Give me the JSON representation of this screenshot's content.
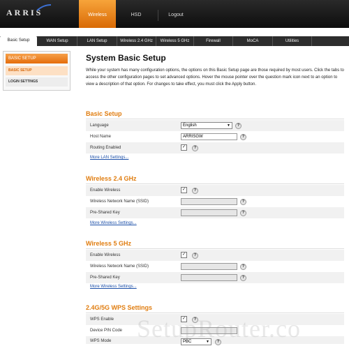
{
  "brand": {
    "name": "ARRIS"
  },
  "topnav": [
    {
      "label": "Wireless"
    },
    {
      "label": "HSD"
    },
    {
      "label": "Logout"
    }
  ],
  "tabs": [
    {
      "label": "Basic Setup"
    },
    {
      "label": "WAN Setup"
    },
    {
      "label": "LAN Setup"
    },
    {
      "label": "Wireless 2.4 GHz"
    },
    {
      "label": "Wireless 5 GHz"
    },
    {
      "label": "Firewall"
    },
    {
      "label": "MoCA"
    },
    {
      "label": "Utilities"
    }
  ],
  "sidebar": {
    "heading": "BASIC SETUP",
    "items": [
      {
        "label": "BASIC SETUP"
      },
      {
        "label": "LOGIN SETTINGS"
      }
    ]
  },
  "page": {
    "title": "System Basic Setup",
    "intro": "While your system has many configuration options, the options on this Basic Setup page are those required by most users. Click the tabs to access the other configuration pages to set advanced options. Hover the mouse pointer over the question mark icon next to an option to view a description of that option. For changes to take effect, you must click the Apply button."
  },
  "basic": {
    "title": "Basic Setup",
    "language_label": "Language",
    "language_value": "English",
    "hostname_label": "Host Name",
    "hostname_value": "ARRISGW",
    "routing_label": "Routing Enabled",
    "more": "More LAN Settings..."
  },
  "w24": {
    "title": "Wireless 2.4 GHz",
    "enable_label": "Enable Wireless",
    "ssid_label": "Wireless Network Name (SSID)",
    "psk_label": "Pre-Shared Key",
    "more": "More Wireless Settings..."
  },
  "w5": {
    "title": "Wireless 5 GHz",
    "enable_label": "Enable Wireless",
    "ssid_label": "Wireless Network Name (SSID)",
    "psk_label": "Pre-Shared Key",
    "more": "More Wireless Settings..."
  },
  "wps": {
    "title": "2.4G/5G WPS Settings",
    "enable_label": "WPS Enable",
    "pin_label": "Device PIN Code",
    "mode_label": "WPS Mode",
    "mode_value": "PBC"
  },
  "help_glyph": "?",
  "check_glyph": "✓",
  "watermark": "SetupRouter.co",
  "colors": {
    "accent": "#e07d10",
    "link": "#1a4ea8"
  }
}
